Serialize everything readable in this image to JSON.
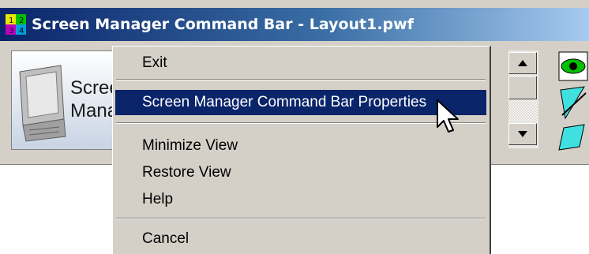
{
  "window": {
    "title": "Screen Manager Command Bar - Layout1.pwf"
  },
  "logo": {
    "text": "Scree\nManag"
  },
  "context_menu": {
    "items": [
      {
        "label": "Exit"
      },
      {
        "label": "Screen Manager Command Bar Properties",
        "selected": true
      },
      {
        "label": "Minimize View"
      },
      {
        "label": "Restore View"
      },
      {
        "label": "Help"
      },
      {
        "label": "Cancel"
      }
    ]
  },
  "icons": {
    "app": "app-grid-icon",
    "scroll_up": "arrow-up-icon",
    "scroll_down": "arrow-down-icon",
    "eye": "eye-icon",
    "tools": "drawing-tools-icon",
    "cursor": "mouse-pointer-icon"
  },
  "colors": {
    "title_bar": "#0a246a",
    "menu_highlight": "#0a246a",
    "face": "#d4d0c8"
  }
}
